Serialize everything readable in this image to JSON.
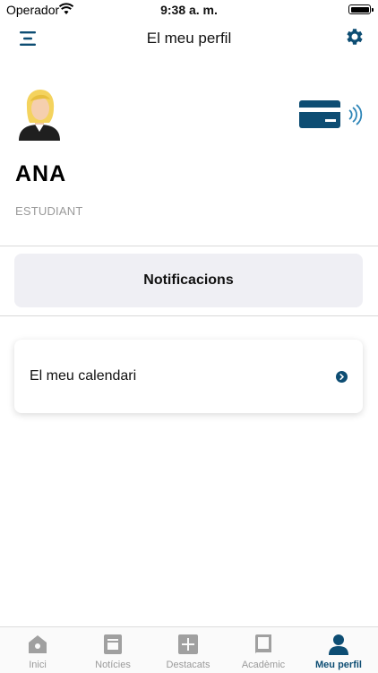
{
  "status_bar": {
    "carrier": "Operador",
    "time": "9:38 a. m."
  },
  "header": {
    "title": "El meu perfil",
    "menu_icon": "menu-icon",
    "settings_icon": "gear-icon"
  },
  "profile": {
    "name": "ANA",
    "role": "ESTUDIANT",
    "avatar_icon": "avatar-icon",
    "card_icon": "contactless-card-icon"
  },
  "notifications_button": {
    "label": "Notificacions"
  },
  "calendar_card": {
    "label": "El meu calendari",
    "chevron_icon": "chevron-right-icon"
  },
  "tabs": [
    {
      "label": "Inici",
      "icon": "home-icon"
    },
    {
      "label": "Notícies",
      "icon": "news-icon"
    },
    {
      "label": "Destacats",
      "icon": "plus-icon"
    },
    {
      "label": "Acadèmic",
      "icon": "book-icon"
    },
    {
      "label": "Meu perfil",
      "icon": "person-icon",
      "active": true
    }
  ],
  "colors": {
    "accent": "#0d4d73",
    "inactive": "#9a9a9a",
    "button_bg": "#efeff4"
  }
}
